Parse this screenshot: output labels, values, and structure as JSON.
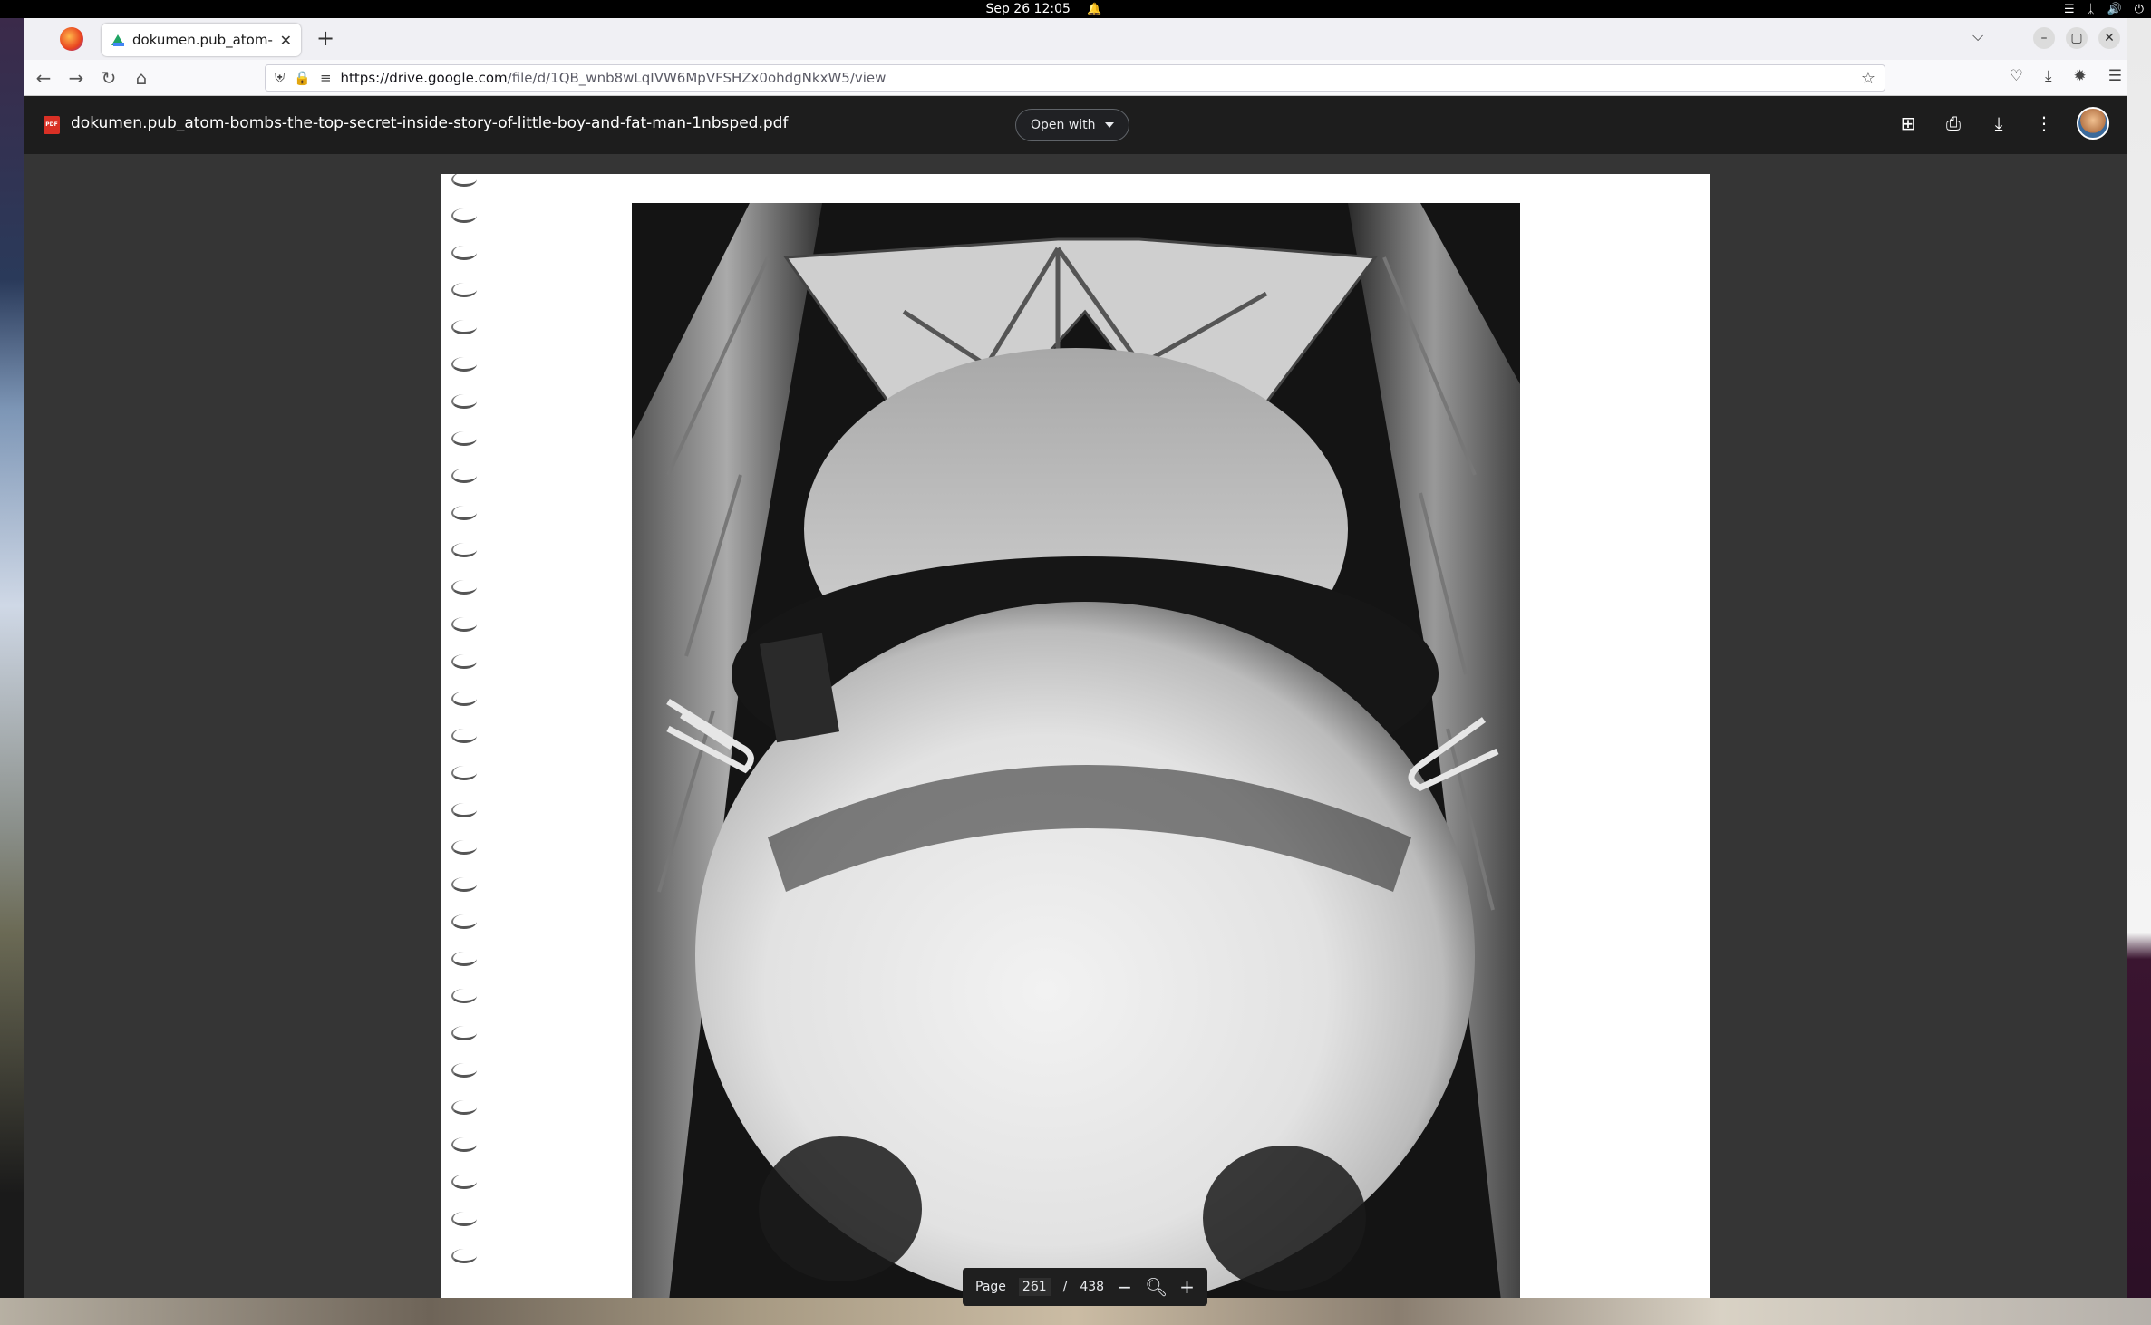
{
  "topbar": {
    "datetime": "Sep 26  12:05"
  },
  "browser": {
    "tab_title": "dokumen.pub_atom-bom",
    "url_host": "https://drive.google.com",
    "url_path": "/file/d/1QB_wnb8wLqIVW6MpVFSHZx0ohdgNkxW5/view"
  },
  "viewer": {
    "file_name": "dokumen.pub_atom-bombs-the-top-secret-inside-story-of-little-boy-and-fat-man-1nbsped.pdf",
    "open_with_label": "Open with",
    "pdf_badge": "PDF"
  },
  "pager": {
    "page_label": "Page",
    "current_page": "261",
    "separator": "/",
    "total_pages": "438"
  },
  "icons": {
    "browser": [
      "firefox-icon",
      "google-drive-icon",
      "close-icon",
      "new-tab-icon",
      "list-all-tabs-icon",
      "minimize-icon",
      "maximize-icon",
      "window-close-icon",
      "back-icon",
      "forward-icon",
      "reload-icon",
      "home-icon",
      "shield-icon",
      "lock-icon",
      "permissions-icon",
      "bookmark-star-icon",
      "pocket-icon",
      "downloads-icon",
      "extensions-icon",
      "menu-icon"
    ],
    "viewer": [
      "pdf-icon",
      "add-comment-icon",
      "print-icon",
      "download-icon",
      "more-options-icon",
      "zoom-out-icon",
      "zoom-icon",
      "zoom-in-icon"
    ]
  },
  "colors": {
    "viewer_bg": "#353535",
    "header_bg": "#1c1c1c",
    "pdf_red": "#d93025"
  }
}
